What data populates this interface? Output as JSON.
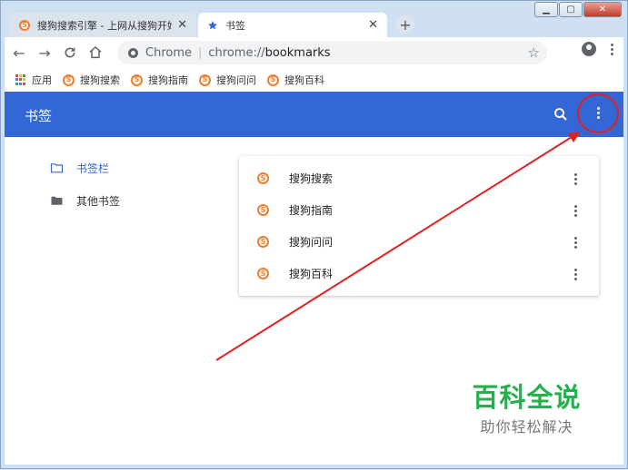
{
  "window": {
    "min_glyph": "▁",
    "max_glyph": "▢",
    "close_glyph": "✕"
  },
  "tabs": [
    {
      "label": "搜狗搜索引擎 - 上网从搜狗开始",
      "close": "✕",
      "icon": "sogou-icon"
    },
    {
      "label": "书签",
      "close": "✕",
      "icon": "star-icon",
      "active": true
    }
  ],
  "new_tab": "+",
  "toolbar": {
    "back": "←",
    "forward": "→",
    "reload": "C",
    "home": "⌂",
    "omnibox": {
      "site_label": "Chrome",
      "separator": "|",
      "url_scheme": "chrome://",
      "url_host": "bookmarks"
    },
    "star": "☆"
  },
  "bookmarks_bar": [
    {
      "label": "应用",
      "icon": "apps-grid-icon"
    },
    {
      "label": "搜狗搜索",
      "icon": "sogou-icon"
    },
    {
      "label": "搜狗指南",
      "icon": "sogou-icon"
    },
    {
      "label": "搜狗问问",
      "icon": "sogou-icon"
    },
    {
      "label": "搜狗百科",
      "icon": "sogou-icon"
    }
  ],
  "header": {
    "title": "书签"
  },
  "sidebar": {
    "items": [
      {
        "label": "书签栏",
        "selected": true,
        "icon": "folder-open-icon"
      },
      {
        "label": "其他书签",
        "selected": false,
        "icon": "folder-icon"
      }
    ]
  },
  "bookmarks": [
    {
      "label": "搜狗搜索"
    },
    {
      "label": "搜狗指南"
    },
    {
      "label": "搜狗问问"
    },
    {
      "label": "搜狗百科"
    }
  ],
  "sogou_glyph": "S",
  "watermark": {
    "line1": "百科全说",
    "line2": "助你轻松解决"
  },
  "colors": {
    "accent": "#3367d6",
    "annotation": "#e02020",
    "sogou": "#f07d2c",
    "watermark": "#23b14d"
  }
}
